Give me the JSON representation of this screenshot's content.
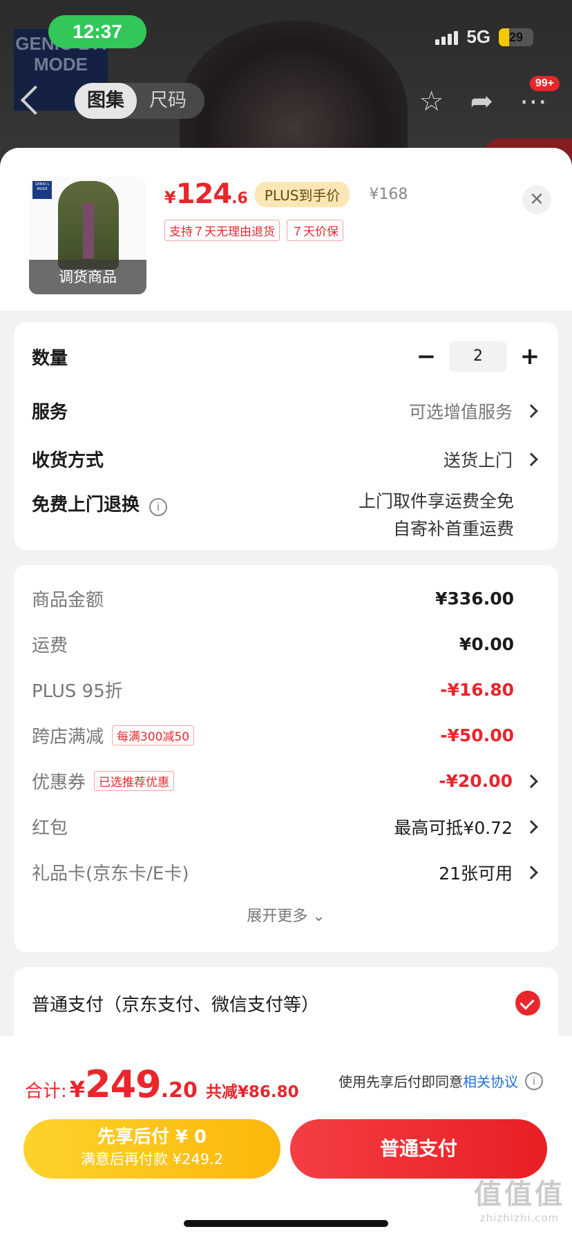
{
  "status_bar": {
    "time": "12:37",
    "network": "5G",
    "battery": "29",
    "battery_level": 0.29
  },
  "background_page": {
    "logo_text": "GENIO L A MODE",
    "tabs": [
      {
        "label": "图集",
        "active": true
      },
      {
        "label": "尺码",
        "active": false
      }
    ],
    "message_badge": "99+"
  },
  "product": {
    "image_caption": "调货商品",
    "price_symbol": "¥",
    "price_main": "124",
    "price_decimal": ".6",
    "plus_tag": "PLUS到手价",
    "original_price": "¥168",
    "tags": [
      "支持７天无理由退货",
      "７天价保"
    ]
  },
  "options": {
    "quantity_label": "数量",
    "quantity_value": "2",
    "service_label": "服务",
    "service_value": "可选增值服务",
    "delivery_label": "收货方式",
    "delivery_value": "送货上门",
    "free_return_label": "免费上门退换",
    "free_return_line1": "上门取件享运费全免",
    "free_return_line2": "自寄补首重运费"
  },
  "costs": {
    "rows": [
      {
        "label": "商品金额",
        "value": "¥336.00"
      },
      {
        "label": "运费",
        "value": "¥0.00"
      },
      {
        "label": "PLUS 95折",
        "value": "-¥16.80"
      },
      {
        "label": "跨店满减",
        "tag": "每满300减50",
        "value": "-¥50.00"
      },
      {
        "label": "优惠券",
        "tag": "已选推荐优惠",
        "value": "-¥20.00"
      },
      {
        "label": "红包",
        "value": "最高可抵¥0.72"
      },
      {
        "label": "礼品卡(京东卡/E卡)",
        "value": "21张可用"
      }
    ],
    "expand_label": "展开更多"
  },
  "payment": {
    "method_label": "普通支付（京东支付、微信支付等）"
  },
  "bottom_bar": {
    "total_label": "合计:",
    "total_symbol": "¥",
    "total_main": "249",
    "total_decimal": ".20",
    "total_saving": "共减¥86.80",
    "agree_text": "使用先享后付即同意",
    "agree_link": "相关协议",
    "pay_later_line1": "先享后付 ¥ 0",
    "pay_later_line2": "满意后再付款 ¥249.2",
    "pay_now_label": "普通支付"
  },
  "watermark": {
    "big": "值值值",
    "small": "zhizhizhi.com"
  },
  "colors": {
    "accent_red": "#e8262c",
    "gold": "#fbb80b",
    "status_green": "#33c759",
    "link_blue": "#1f6fd6"
  }
}
